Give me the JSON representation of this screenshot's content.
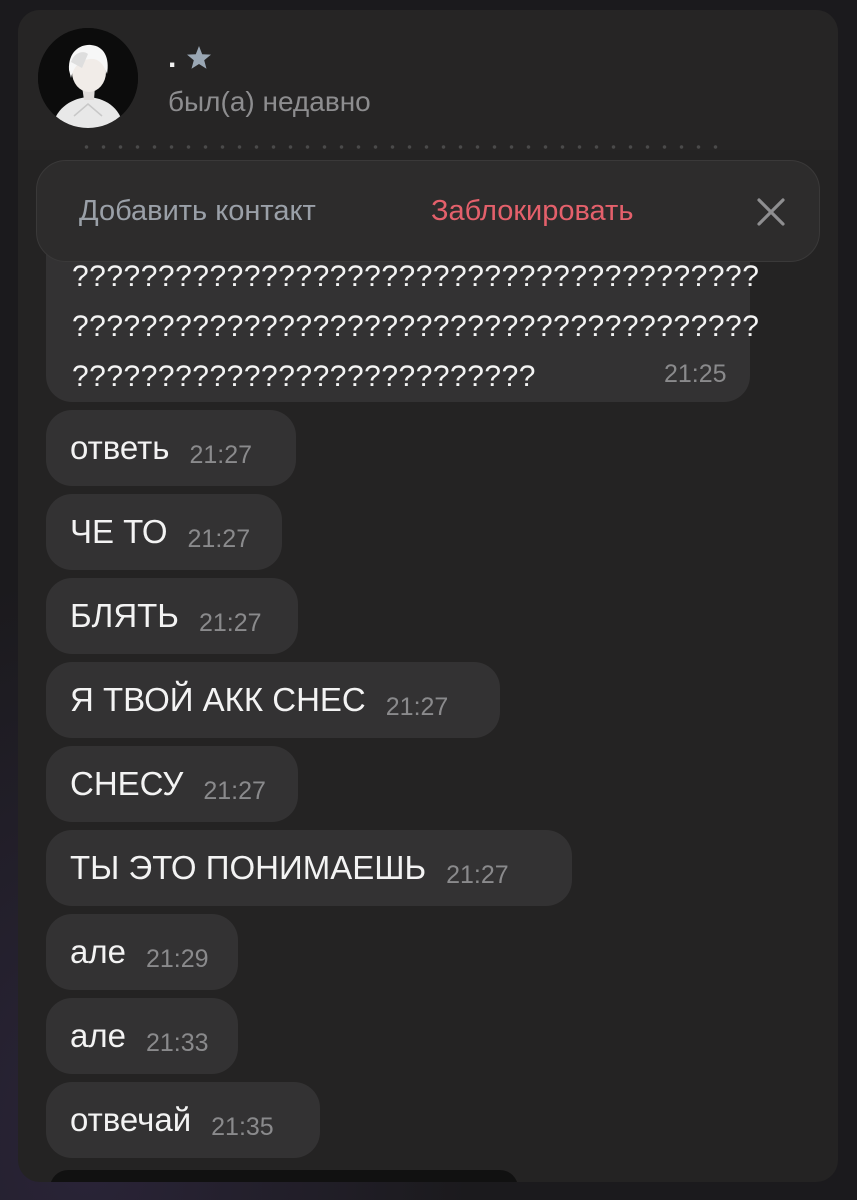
{
  "header": {
    "name": ".",
    "status": "был(а) недавно"
  },
  "action_bar": {
    "add_contact": "Добавить контакт",
    "block": "Заблокировать"
  },
  "long_message": {
    "lines": [
      "????????????????????????????????????????",
      "????????????????????????????????????????",
      "???????????????????????????"
    ],
    "time": "21:25"
  },
  "messages": [
    {
      "text": "ответь",
      "time": "21:27"
    },
    {
      "text": "ЧЕ ТО",
      "time": "21:27"
    },
    {
      "text": "БЛЯТЬ",
      "time": "21:27"
    },
    {
      "text": "Я ТВОЙ АКК СНЕС",
      "time": "21:27"
    },
    {
      "text": "СНЕСУ",
      "time": "21:27"
    },
    {
      "text": "ТЫ ЭТО ПОНИМАЕШЬ",
      "time": "21:27"
    },
    {
      "text": "але",
      "time": "21:29"
    },
    {
      "text": "але",
      "time": "21:33"
    },
    {
      "text": "отвечай",
      "time": "21:35"
    }
  ],
  "colors": {
    "block": "#e4606b",
    "add_contact": "#9aa0a8",
    "bubble": "#333233"
  },
  "icons": [
    "star-icon",
    "close-icon",
    "avatar"
  ]
}
